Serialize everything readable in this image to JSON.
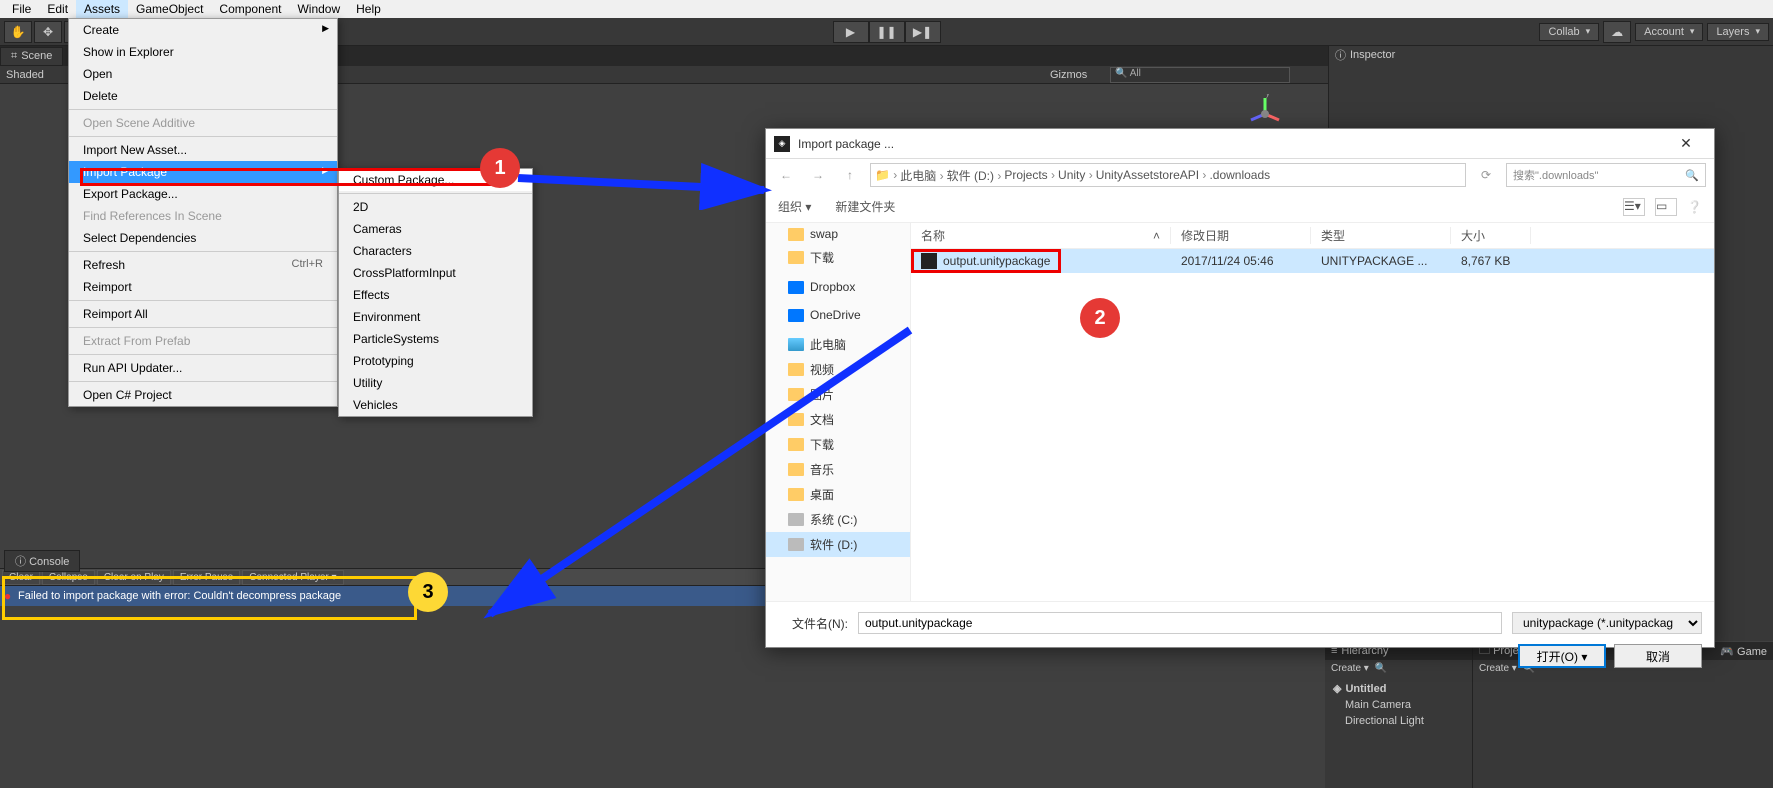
{
  "menubar": [
    "File",
    "Edit",
    "Assets",
    "GameObject",
    "Component",
    "Window",
    "Help"
  ],
  "menubar_active": "Assets",
  "toolbar_right": {
    "collab": "Collab",
    "account": "Account",
    "layers": "Layers"
  },
  "scene_tab": "Scene",
  "scene_shaded": "Shaded",
  "gizmos": "Gizmos",
  "search_q": "All",
  "inspector_tab": "Inspector",
  "dropdown_assets": [
    "Create",
    "Show in Explorer",
    "Open",
    "Delete",
    "-",
    "Open Scene Additive",
    "-",
    "Import New Asset...",
    "Import Package",
    "Export Package...",
    "Find References In Scene",
    "Select Dependencies",
    "-",
    "Refresh",
    "Reimport",
    "-",
    "Reimport All",
    "-",
    "Extract From Prefab",
    "-",
    "Run API Updater...",
    "-",
    "Open C# Project"
  ],
  "dropdown_refresh_shortcut": "Ctrl+R",
  "dropdown_import_sub": [
    "Custom Package...",
    "-",
    "2D",
    "Cameras",
    "Characters",
    "CrossPlatformInput",
    "Effects",
    "Environment",
    "ParticleSystems",
    "Prototyping",
    "Utility",
    "Vehicles"
  ],
  "dialog": {
    "title": "Import package ...",
    "crumbs": [
      "此电脑",
      "软件 (D:)",
      "Projects",
      "Unity",
      "UnityAssetstoreAPI",
      ".downloads"
    ],
    "search_placeholder": "搜索\".downloads\"",
    "organize": "组织",
    "newfolder": "新建文件夹",
    "columns": {
      "name": "名称",
      "date": "修改日期",
      "type": "类型",
      "size": "大小"
    },
    "tree": [
      {
        "label": "swap",
        "icon": "folder"
      },
      {
        "label": "下载",
        "icon": "folder"
      },
      {
        "label": "Dropbox",
        "icon": "cloud"
      },
      {
        "label": "OneDrive",
        "icon": "cloud"
      },
      {
        "label": "此电脑",
        "icon": "pc"
      },
      {
        "label": "视频",
        "icon": "folder"
      },
      {
        "label": "图片",
        "icon": "folder"
      },
      {
        "label": "文档",
        "icon": "folder"
      },
      {
        "label": "下载",
        "icon": "folder"
      },
      {
        "label": "音乐",
        "icon": "folder"
      },
      {
        "label": "桌面",
        "icon": "folder"
      },
      {
        "label": "系统 (C:)",
        "icon": "drive"
      },
      {
        "label": "软件 (D:)",
        "icon": "drive",
        "sel": true
      }
    ],
    "row": {
      "name": "output.unitypackage",
      "date": "2017/11/24 05:46",
      "type": "UNITYPACKAGE ...",
      "size": "8,767 KB"
    },
    "filename_label": "文件名(N):",
    "filename_value": "output.unitypackage",
    "filter": "unitypackage (*.unitypackag",
    "open": "打开(O)",
    "cancel": "取消"
  },
  "console": {
    "tab": "Console",
    "buttons": [
      "Clear",
      "Collapse",
      "Clear on Play",
      "Error Pause",
      "Connected Player ▾"
    ],
    "error": "Failed to import package with error: Couldn't decompress package"
  },
  "hierarchy": {
    "tab": "Hierarchy",
    "create": "Create",
    "scene": "Untitled",
    "items": [
      "Main Camera",
      "Directional Light"
    ]
  },
  "project": {
    "tab": "Project",
    "game_tab": "Game",
    "create": "Create"
  }
}
